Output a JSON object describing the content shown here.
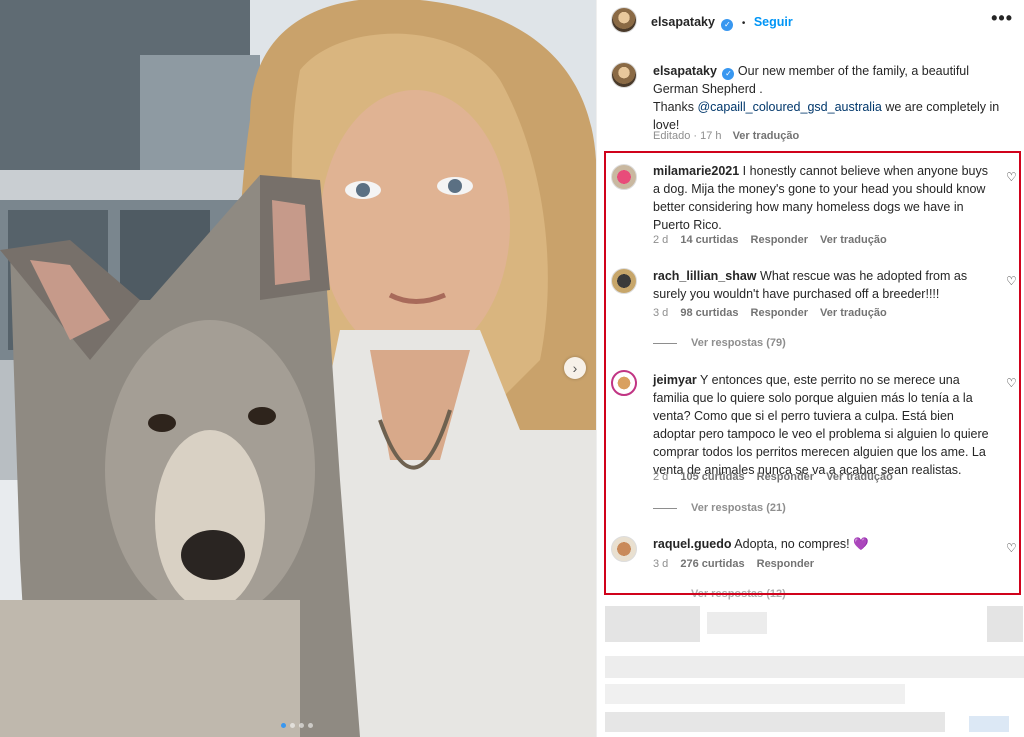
{
  "post": {
    "username": "elsapataky",
    "separator": "•",
    "follow_label": "Seguir",
    "more_label": "•••",
    "caption_text_1": "Our new member of the family, a beautiful German Shepherd .",
    "caption_thanks": "Thanks",
    "caption_mention": "@capaill_coloured_gsd_australia",
    "caption_text_2": "we are completely in love!",
    "edited": "Editado · 17 h",
    "translate": "Ver tradução"
  },
  "comments": [
    {
      "username": "milamarie2021",
      "text": "I honestly cannot believe when anyone buys a dog. Mija the money's gone to your head you should know better considering how many homeless dogs we have in Puerto Rico.",
      "age": "2 d",
      "likes": "14 curtidas",
      "reply": "Responder",
      "translate": "Ver tradução"
    },
    {
      "username": "rach_lillian_shaw",
      "text": "What rescue was he adopted from as surely you wouldn't have purchased off a breeder!!!!",
      "age": "3 d",
      "likes": "98 curtidas",
      "reply": "Responder",
      "translate": "Ver tradução",
      "view_replies": "Ver respostas (79)"
    },
    {
      "username": "jeimyar",
      "text": "Y entonces que, este perrito no se merece una familia que lo quiere solo porque alguien más lo tenía a la venta? Como que si el perro tuviera a culpa. Está bien adoptar pero tampoco le veo el problema si alguien lo quiere comprar todos los perritos merecen alguien que los ame. La venta de animales nunca se va a acabar sean realistas.",
      "age": "2 d",
      "likes": "105 curtidas",
      "reply": "Responder",
      "translate": "Ver tradução",
      "view_replies": "Ver respostas (21)"
    },
    {
      "username": "raquel.guedo",
      "text": "Adopta, no compres!",
      "emoji": "💜",
      "age": "3 d",
      "likes": "276 curtidas",
      "reply": "Responder",
      "view_replies": "Ver respostas (12)"
    }
  ],
  "icons": {
    "verified": "verified-badge-icon",
    "heart": "heart-outline-icon",
    "next": "chevron-right-icon",
    "more": "more-horizontal-icon"
  },
  "glyphs": {
    "heart": "♡",
    "next": "›",
    "check": "✓"
  },
  "colors": {
    "accent": "#0095f6",
    "highlight": "#d0021b",
    "verified": "#3897f0"
  }
}
